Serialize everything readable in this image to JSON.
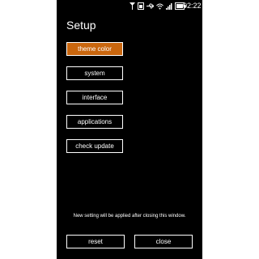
{
  "status_bar": {
    "time": "02:22",
    "icons": [
      "signal-icon",
      "sim-icon",
      "usb-icon",
      "wifi-icon",
      "cellular-bars-icon",
      "battery-icon"
    ]
  },
  "setup": {
    "title": "Setup",
    "menu": [
      {
        "label": "theme color",
        "active": true
      },
      {
        "label": "system",
        "active": false
      },
      {
        "label": "interface",
        "active": false
      },
      {
        "label": "applications",
        "active": false
      },
      {
        "label": "check update",
        "active": false
      }
    ],
    "notice": "New setting will be applied after closing this window.",
    "reset_label": "reset",
    "close_label": "close"
  },
  "colors": {
    "accent": "#c9660e",
    "background": "#000000",
    "foreground": "#ffffff"
  }
}
